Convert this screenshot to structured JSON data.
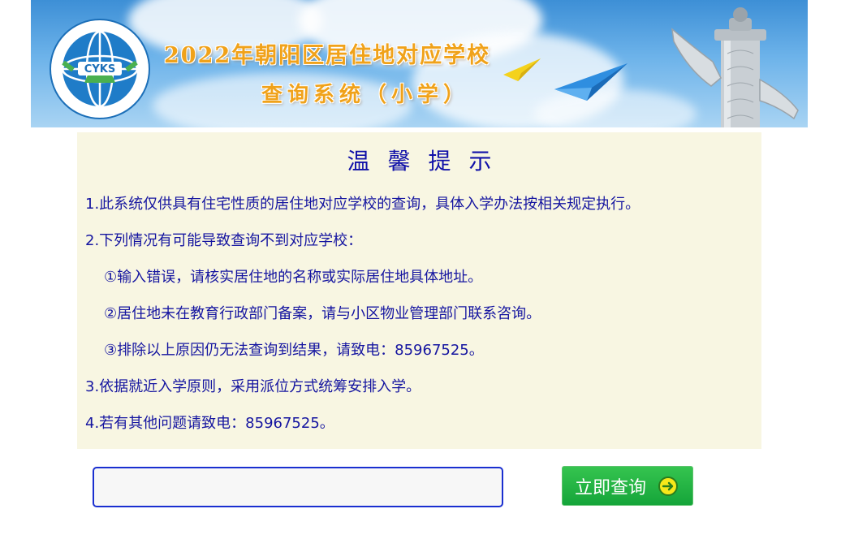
{
  "banner": {
    "title_line1": "2022年朝阳区居住地对应学校",
    "title_line2": "查询系统（小学）",
    "logo_text": "CYKS",
    "logo_ring_text": "北京市朝阳区招生考试中心"
  },
  "notice": {
    "title": "温馨提示",
    "items": [
      "1.此系统仅供具有住宅性质的居住地对应学校的查询，具体入学办法按相关规定执行。",
      "2.下列情况有可能导致查询不到对应学校：",
      "①输入错误，请核实居住地的名称或实际居住地具体地址。",
      "②居住地未在教育行政部门备案，请与小区物业管理部门联系咨询。",
      "③排除以上原因仍无法查询到结果，请致电：85967525。",
      "3.依据就近入学原则，采用派位方式统筹安排入学。",
      "4.若有其他问题请致电：85967525。"
    ]
  },
  "search": {
    "input_value": "",
    "input_placeholder": "",
    "button_label": "立即查询",
    "button_icon": "arrow-right-circle-icon"
  },
  "colors": {
    "notice_text": "#1515a0",
    "notice_bg": "#f8f6e2",
    "banner_title": "#f0a21a",
    "button_green": "#1aaa3e",
    "input_border": "#1a2fd0"
  }
}
